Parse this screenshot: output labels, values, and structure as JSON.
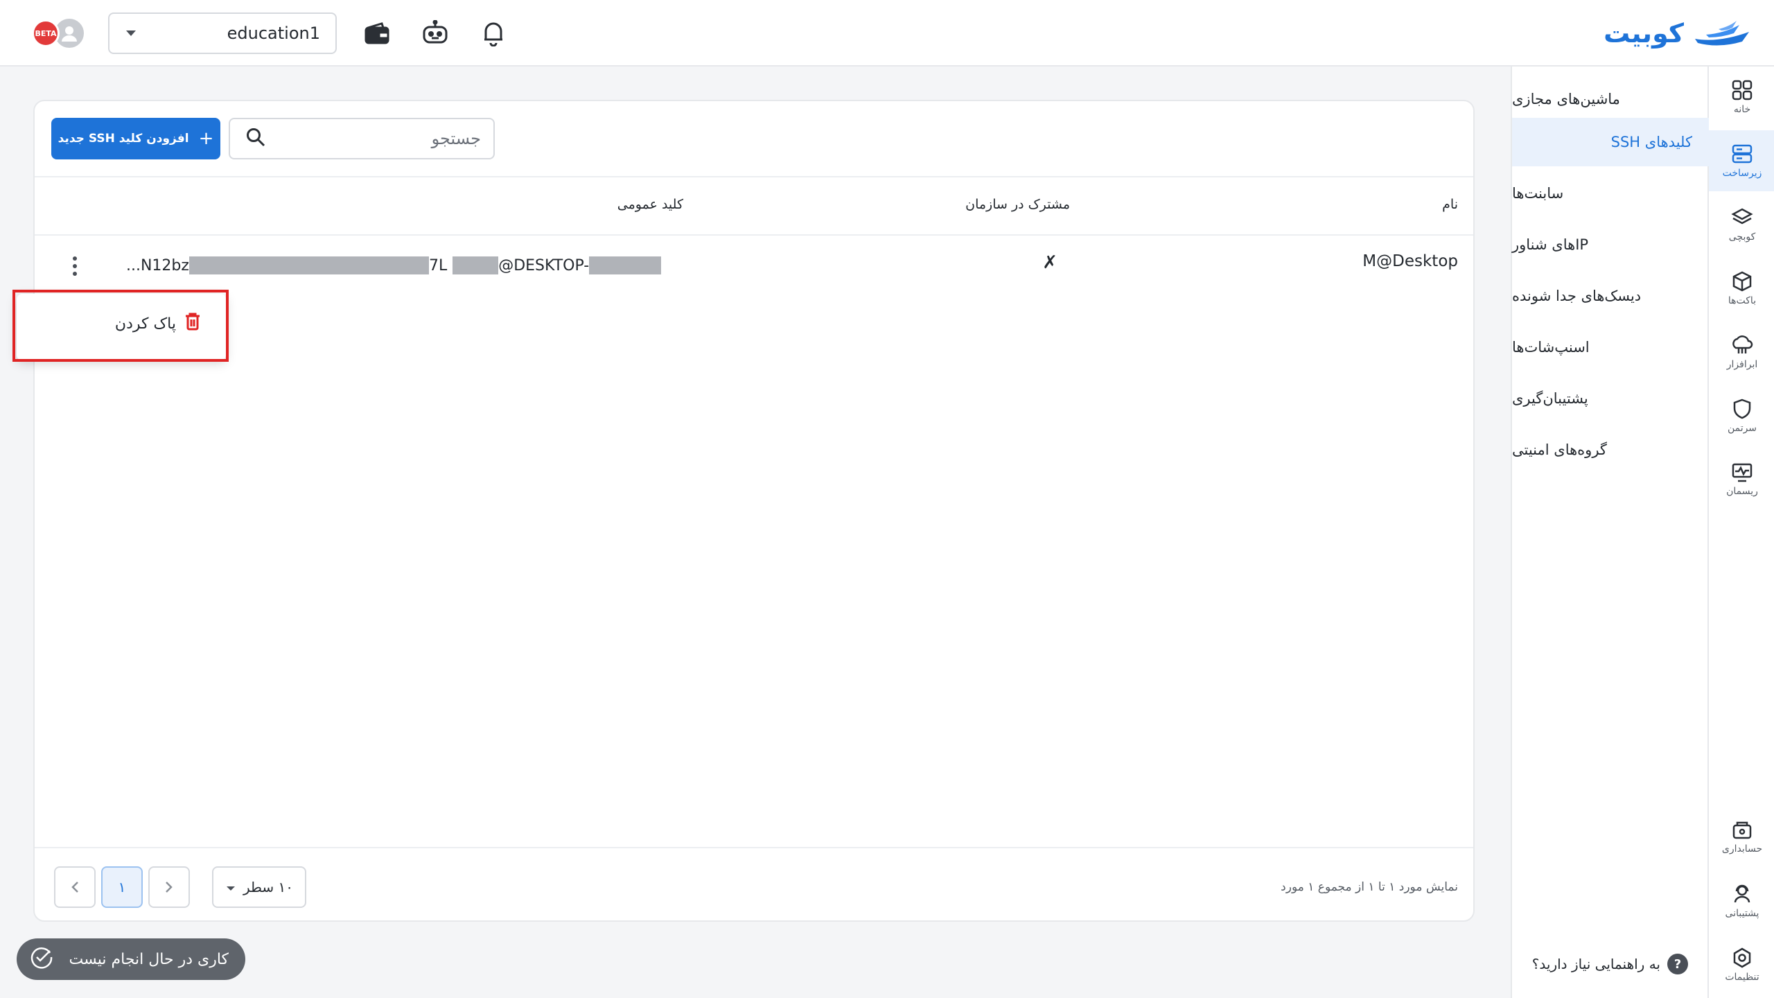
{
  "header": {
    "logo_text": "کوبیت",
    "project": "education1",
    "badge_text": "BETA"
  },
  "rail": {
    "items": [
      {
        "label": "خانه",
        "icon": "grid-icon"
      },
      {
        "label": "زیرساخت",
        "icon": "server-icon"
      },
      {
        "label": "کوبچی",
        "icon": "layers-icon"
      },
      {
        "label": "باکت‌ها",
        "icon": "cube-icon"
      },
      {
        "label": "ابرافزار",
        "icon": "cloud-icon"
      },
      {
        "label": "سرتمن",
        "icon": "shield-icon"
      },
      {
        "label": "ریسمان",
        "icon": "monitor-icon"
      },
      {
        "label": "حسابداری",
        "icon": "wallet-icon"
      },
      {
        "label": "پشتیبانی",
        "icon": "support-icon"
      },
      {
        "label": "تنظیمات",
        "icon": "gear-icon"
      }
    ]
  },
  "subnav": {
    "items": [
      "ماشین‌های مجازی",
      "کلیدهای SSH",
      "سابنت‌ها",
      "IPهای شناور",
      "دیسک‌های جدا شونده",
      "اسنپ‌شات‌ها",
      "پشتیبان‌گیری",
      "گروه‌های امنیتی"
    ],
    "help": "به راهنمایی نیاز دارید؟"
  },
  "toolbar": {
    "add_label": "افزودن کلید SSH جدید",
    "search_placeholder": "جستجو"
  },
  "table": {
    "headers": {
      "name": "نام",
      "shared": "مشترک در سازمان",
      "public_key": "کلید عمومی"
    },
    "rows": [
      {
        "name": "M@Desktop",
        "shared": "✗",
        "key_start": "...N12bz",
        "key_mid": "7L",
        "key_host": "@DESKTOP-"
      }
    ]
  },
  "menu": {
    "delete_label": "پاک کردن"
  },
  "footer": {
    "rows_per_page": "۱۰ سطر",
    "page": "۱",
    "summary": "نمایش مورد ۱ تا ۱ از مجموع ۱ مورد"
  },
  "status": {
    "text": "کاری در حال انجام نیست"
  },
  "colors": {
    "accent": "#1e73d8",
    "danger": "#e02424"
  }
}
